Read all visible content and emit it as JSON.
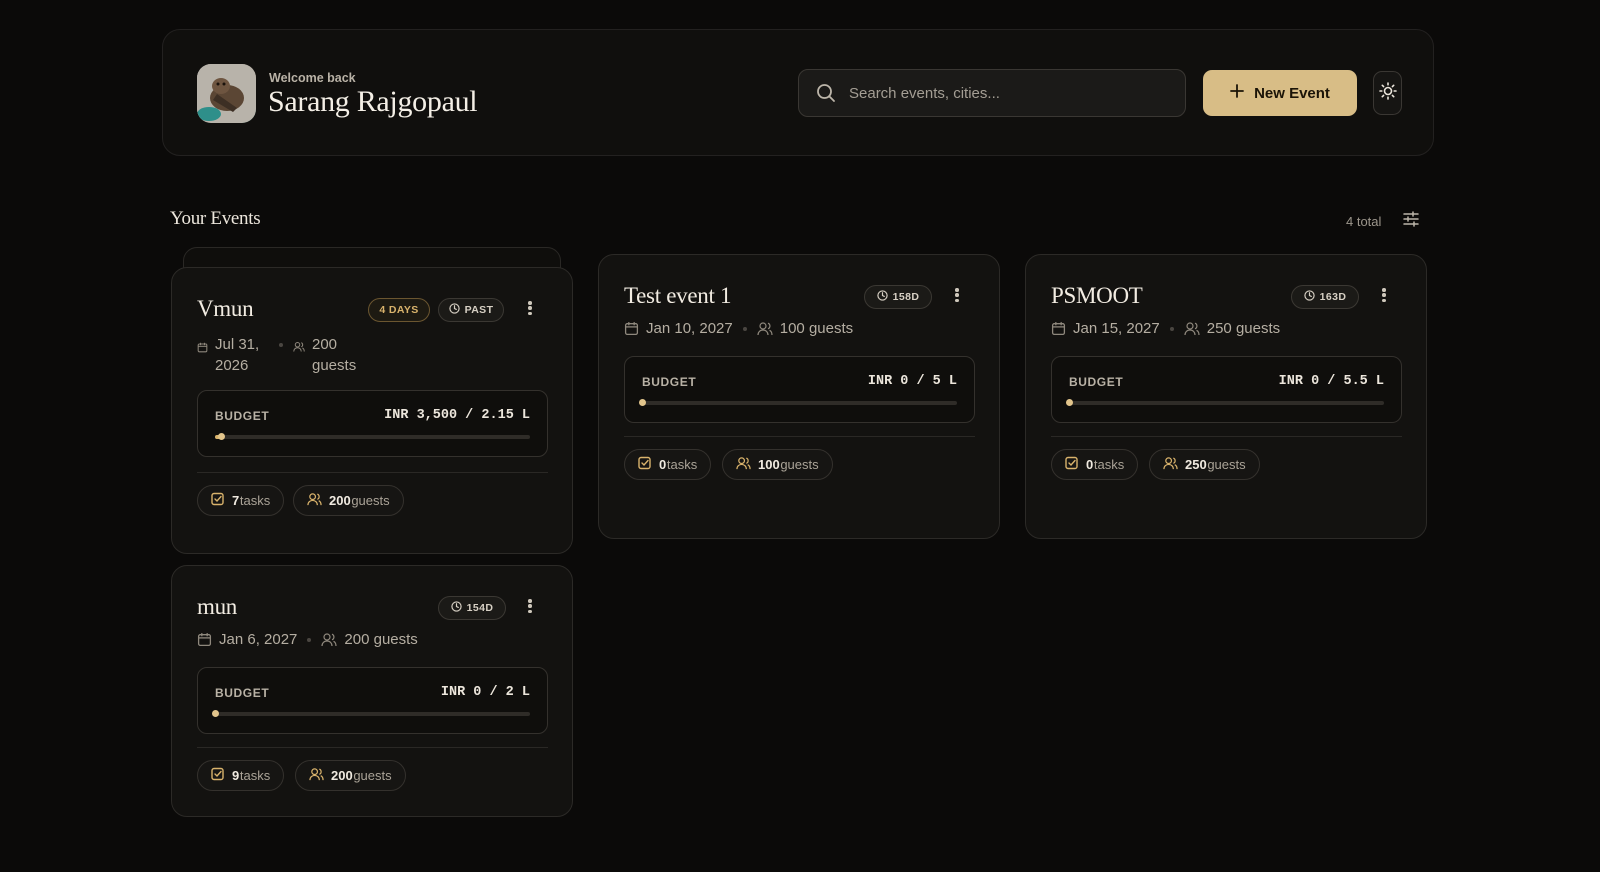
{
  "header": {
    "welcome": "Welcome back",
    "user_name": "Sarang Rajgopaul",
    "search_placeholder": "Search events, cities...",
    "new_event_label": "New Event"
  },
  "section": {
    "title": "Your Events",
    "total": "4 total"
  },
  "colors": {
    "accent": "#d8bd86",
    "background": "#0b0a09",
    "card": "#131210"
  },
  "events": [
    {
      "title": "Vmun",
      "badge_primary": "4 DAYS",
      "badge_secondary": "PAST",
      "date": "Jul 31, 2026",
      "guests_text": "200 guests",
      "budget_label": "BUDGET",
      "budget_value": "INR 3,500 / 2.15 L",
      "budget_progress": 0.02,
      "tasks_count": "7",
      "tasks_label": "tasks",
      "guests_count": "200",
      "guests_label": "guests"
    },
    {
      "title": "Test event 1",
      "badge_primary": "158D",
      "date": "Jan 10, 2027",
      "guests_text": "100 guests",
      "budget_label": "BUDGET",
      "budget_value": "INR 0 / 5 L",
      "budget_progress": 0.0,
      "tasks_count": "0",
      "tasks_label": "tasks",
      "guests_count": "100",
      "guests_label": "guests"
    },
    {
      "title": "PSMOOT",
      "badge_primary": "163D",
      "date": "Jan 15, 2027",
      "guests_text": "250 guests",
      "budget_label": "BUDGET",
      "budget_value": "INR 0 / 5.5 L",
      "budget_progress": 0.0,
      "tasks_count": "0",
      "tasks_label": "tasks",
      "guests_count": "250",
      "guests_label": "guests"
    },
    {
      "title": "mun",
      "badge_primary": "154D",
      "date": "Jan 6, 2027",
      "guests_text": "200 guests",
      "budget_label": "BUDGET",
      "budget_value": "INR 0 / 2 L",
      "budget_progress": 0.0,
      "tasks_count": "9",
      "tasks_label": "tasks",
      "guests_count": "200",
      "guests_label": "guests"
    }
  ]
}
